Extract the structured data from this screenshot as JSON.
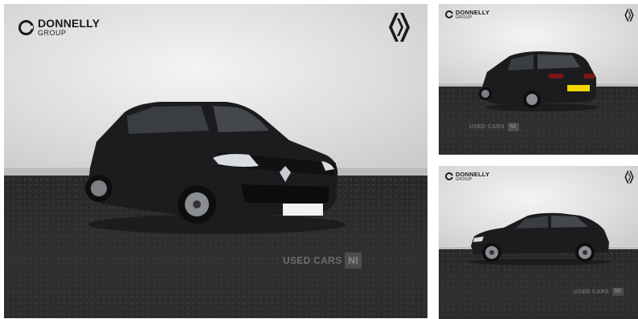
{
  "gallery": {
    "brand": {
      "name": "DONNELLY",
      "sub": "GROUP"
    },
    "watermark": {
      "text": "USED CARS",
      "badge": "NI"
    },
    "photos": [
      {
        "view": "front three-quarter",
        "icon": "car-front-icon"
      },
      {
        "view": "rear three-quarter",
        "icon": "car-rear-icon"
      },
      {
        "view": "side profile",
        "icon": "car-side-icon"
      }
    ],
    "maker_icon": "renault-diamond-icon",
    "colors": {
      "car_body": "#1c1c1e",
      "floor": "#2a2a2a",
      "wall": "#e2e2e2"
    }
  }
}
